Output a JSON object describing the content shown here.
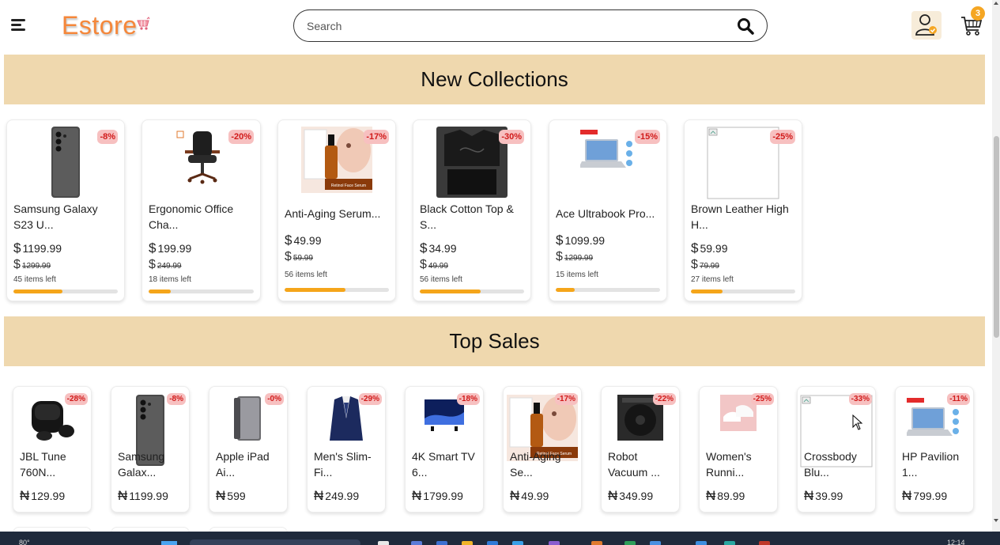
{
  "header": {
    "logo": "Estore",
    "search_placeholder": "Search",
    "cart_count": "3"
  },
  "new_collections": {
    "title": "New Collections",
    "products": [
      {
        "name": "Samsung Galaxy S23 U...",
        "price": "1199.99",
        "old_price": "1299.99",
        "discount": "-8%",
        "stock": "45 items left",
        "stock_ratio": 0.47,
        "image": "phone-image"
      },
      {
        "name": "Ergonomic Office Cha...",
        "price": "199.99",
        "old_price": "249.99",
        "discount": "-20%",
        "stock": "18 items left",
        "stock_ratio": 0.21,
        "image": "office-chair-image"
      },
      {
        "name": "Anti-Aging Serum...",
        "price": "49.99",
        "old_price": "59.99",
        "discount": "-17%",
        "stock": "56 items left",
        "stock_ratio": 0.58,
        "image": "serum-image"
      },
      {
        "name": "Black Cotton Top & S...",
        "price": "34.99",
        "old_price": "49.99",
        "discount": "-30%",
        "stock": "56 items left",
        "stock_ratio": 0.58,
        "image": "clothing-image"
      },
      {
        "name": "Ace Ultrabook Pro...",
        "price": "1099.99",
        "old_price": "1299.99",
        "discount": "-15%",
        "stock": "15 items left",
        "stock_ratio": 0.18,
        "image": "laptop-image"
      },
      {
        "name": "Brown Leather High H...",
        "price": "59.99",
        "old_price": "79.99",
        "discount": "-25%",
        "stock": "27 items left",
        "stock_ratio": 0.3,
        "image": "broken-image"
      }
    ],
    "currency_symbol": "$"
  },
  "top_sales": {
    "title": "Top Sales",
    "currency_symbol": "₦",
    "products": [
      {
        "name": "JBL Tune 760N...",
        "price": "129.99",
        "discount": "-28%",
        "image": "earbuds-image"
      },
      {
        "name": "Samsung Galax...",
        "price": "1199.99",
        "discount": "-8%",
        "image": "phone-image"
      },
      {
        "name": "Apple iPad Ai...",
        "price": "599",
        "discount": "-0%",
        "image": "tablet-image"
      },
      {
        "name": "Men's Slim-Fi...",
        "price": "249.99",
        "discount": "-29%",
        "image": "suit-image"
      },
      {
        "name": "4K Smart TV 6...",
        "price": "1799.99",
        "discount": "-18%",
        "image": "tv-image"
      },
      {
        "name": "Anti-Aging Se...",
        "price": "49.99",
        "discount": "-17%",
        "image": "serum-image"
      },
      {
        "name": "Robot Vacuum ...",
        "price": "349.99",
        "discount": "-22%",
        "image": "vacuum-image"
      },
      {
        "name": "Women's Runni...",
        "price": "89.99",
        "discount": "-25%",
        "image": "shoes-image"
      },
      {
        "name": "Crossbody Blu...",
        "price": "39.99",
        "discount": "-33%",
        "image": "broken-image"
      },
      {
        "name": "HP Pavilion 1...",
        "price": "799.99",
        "discount": "-11%",
        "image": "laptop-image"
      }
    ]
  },
  "taskbar": {
    "weather": "80°",
    "clock": "12:14"
  },
  "colors": {
    "accent": "#f5873a",
    "band": "#efd8ae",
    "discount_bg": "#f7c0c0",
    "discount_text": "#d11a1a",
    "stock_fill": "#f5a51a"
  }
}
